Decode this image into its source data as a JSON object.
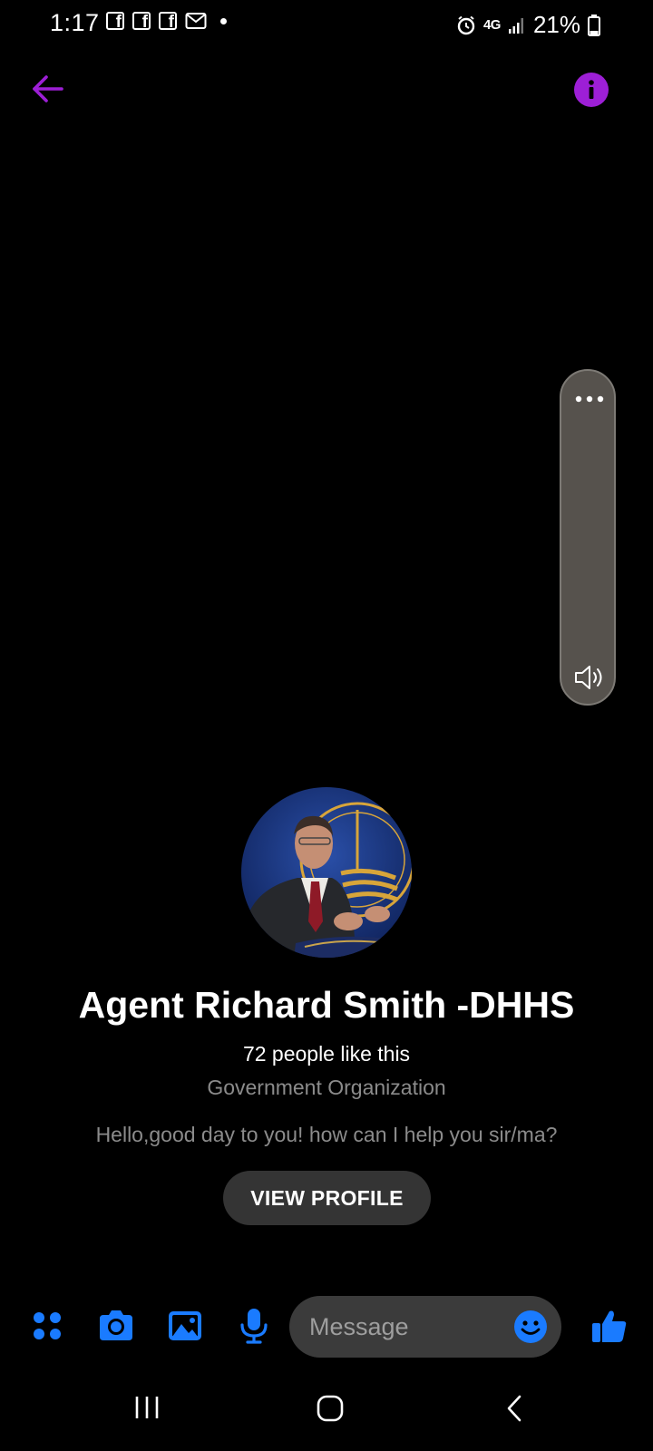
{
  "status_bar": {
    "time": "1:17",
    "network": "4G",
    "battery": "21%"
  },
  "profile": {
    "name": "Agent Richard Smith -DHHS",
    "likes": "72 people like this",
    "category": "Government Organization",
    "greeting": "Hello,good day to you! how can I help you sir/ma?",
    "view_profile_label": "VIEW PROFILE"
  },
  "composer": {
    "placeholder": "Message"
  },
  "colors": {
    "header_accent": "#9d1fd6",
    "composer_accent": "#1a7bff",
    "background": "#000000"
  },
  "icons": {
    "header": [
      "back-arrow-icon",
      "info-icon"
    ],
    "controls": [
      "more-options-icon",
      "volume-icon"
    ],
    "composer": [
      "apps-menu-icon",
      "camera-icon",
      "gallery-icon",
      "microphone-icon",
      "emoji-icon",
      "like-thumbs-up-icon"
    ],
    "nav": [
      "recent-apps-icon",
      "home-icon",
      "back-nav-icon"
    ]
  }
}
